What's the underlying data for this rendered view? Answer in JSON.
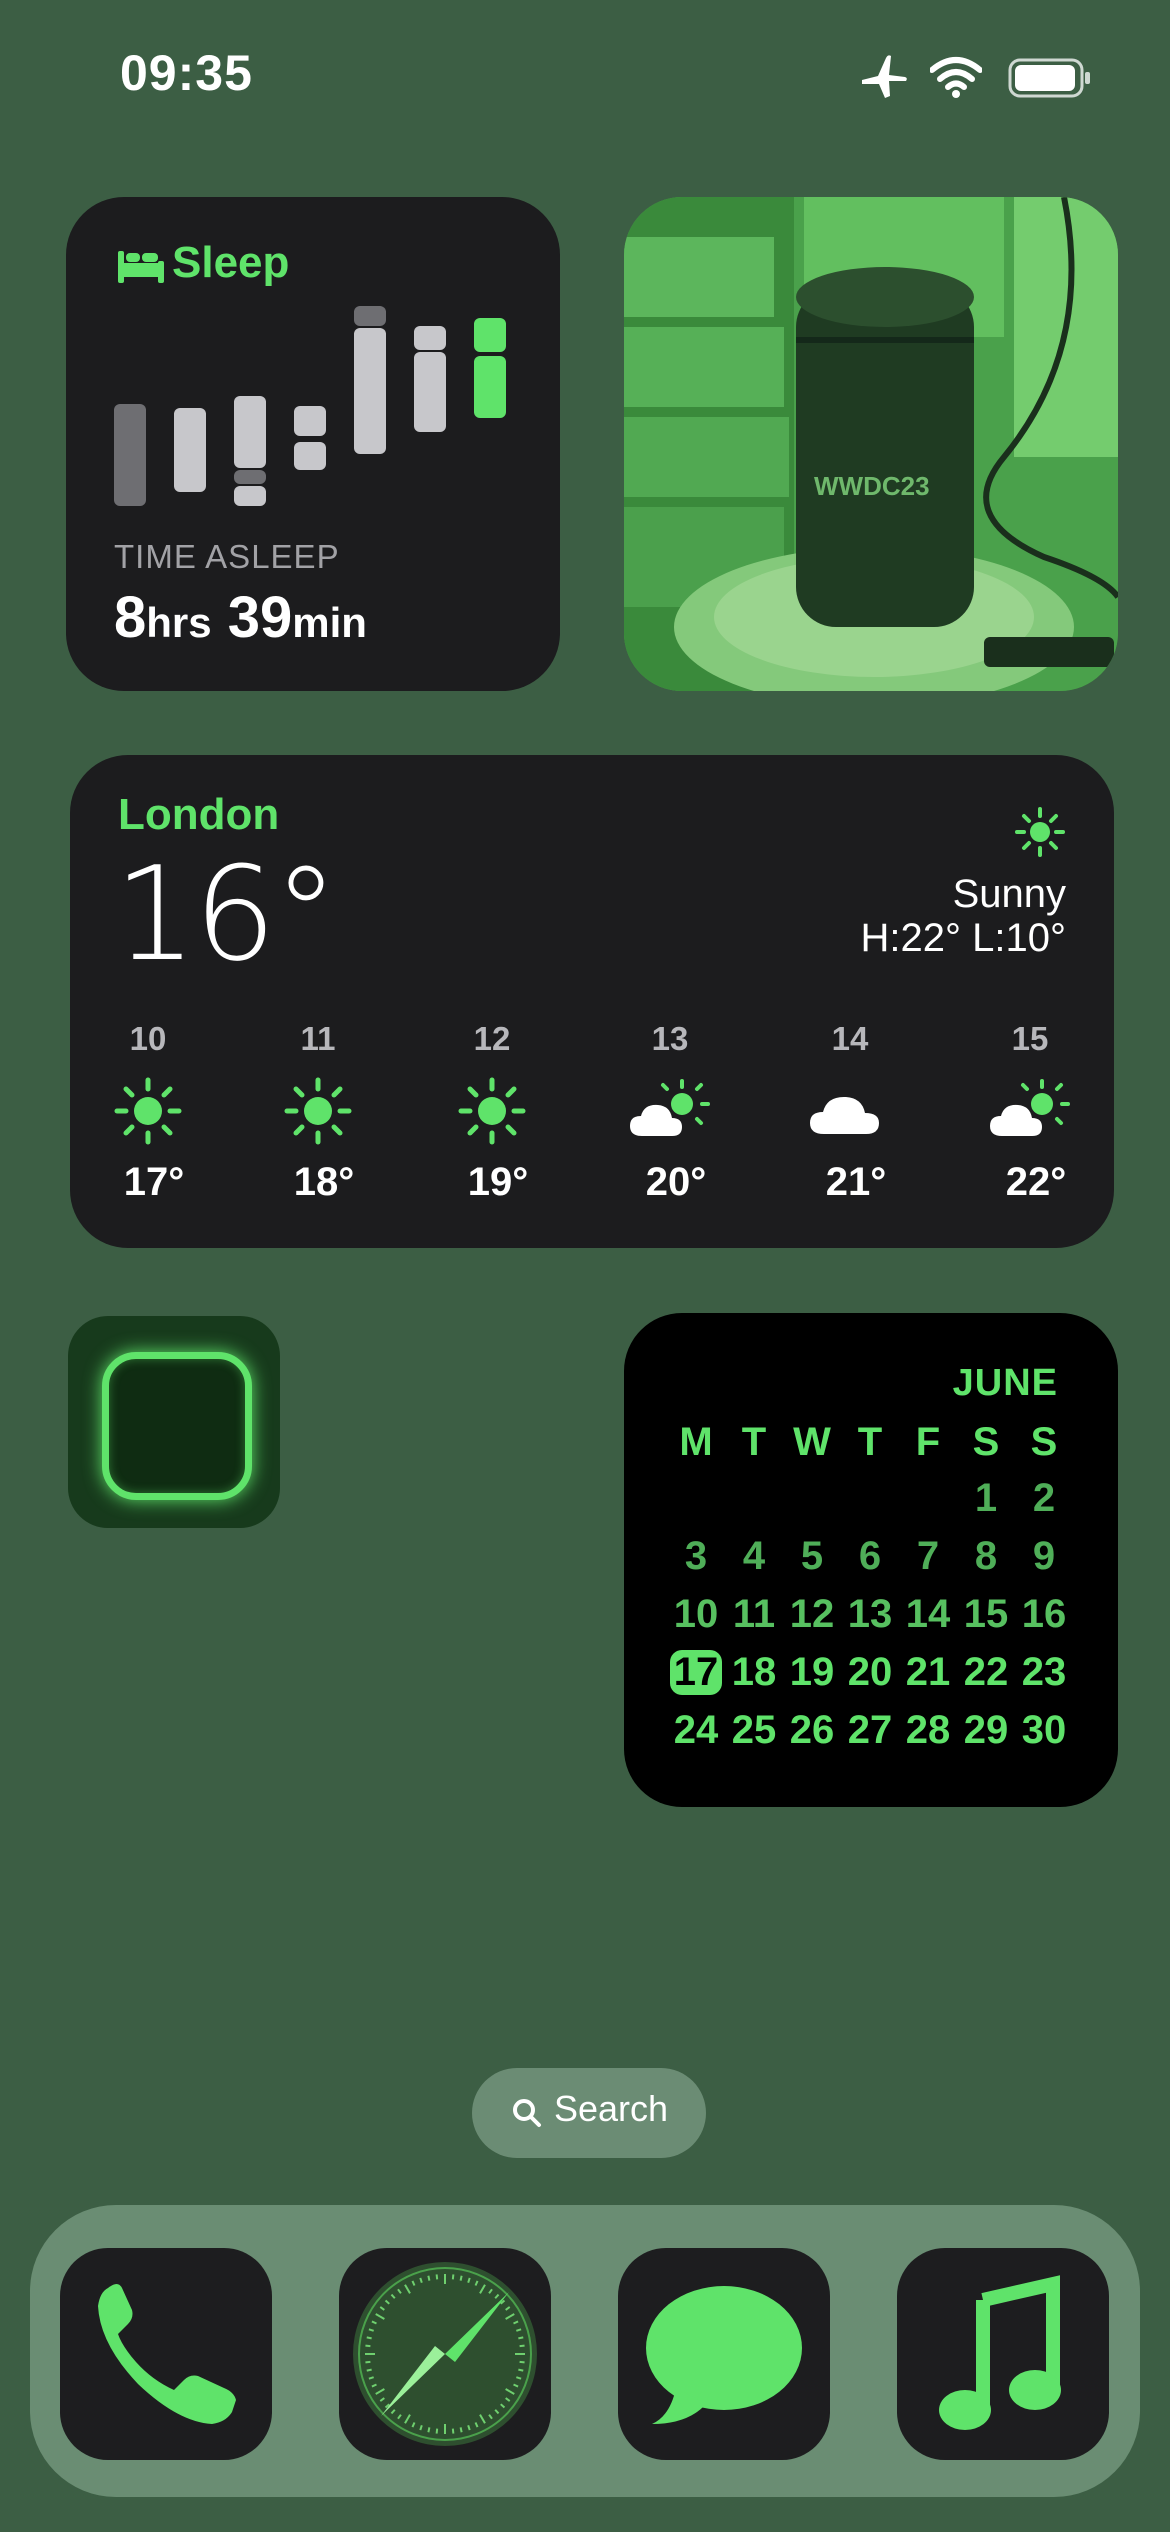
{
  "status_bar": {
    "time": "09:35",
    "icons": [
      "airplane-icon",
      "wifi-icon",
      "battery-icon"
    ]
  },
  "sleep_widget": {
    "title": "Sleep",
    "icon": "bed-icon",
    "label": "TIME ASLEEP",
    "hours": "8",
    "hours_unit": "hrs",
    "minutes": "39",
    "minutes_unit": "min",
    "accent": "#5fe36a"
  },
  "photo_widget": {
    "subject_label": "WWDC23"
  },
  "weather": {
    "city": "London",
    "temperature": "16°",
    "condition": "Sunny",
    "high_low": "H:22° L:10°",
    "condition_icon": "sun-icon",
    "hourly": [
      {
        "hour": "10",
        "icon": "sun-icon",
        "temp": "17°"
      },
      {
        "hour": "11",
        "icon": "sun-icon",
        "temp": "18°"
      },
      {
        "hour": "12",
        "icon": "sun-icon",
        "temp": "19°"
      },
      {
        "hour": "13",
        "icon": "partly-cloudy-icon",
        "temp": "20°"
      },
      {
        "hour": "14",
        "icon": "cloud-icon",
        "temp": "21°"
      },
      {
        "hour": "15",
        "icon": "partly-cloudy-icon",
        "temp": "22°"
      }
    ]
  },
  "calendar": {
    "month": "JUNE",
    "weekdays": [
      "M",
      "T",
      "W",
      "T",
      "F",
      "S",
      "S"
    ],
    "rows": [
      [
        "",
        "",
        "",
        "",
        "",
        "1",
        "2"
      ],
      [
        "3",
        "4",
        "5",
        "6",
        "7",
        "8",
        "9"
      ],
      [
        "10",
        "11",
        "12",
        "13",
        "14",
        "15",
        "16"
      ],
      [
        "17",
        "18",
        "19",
        "20",
        "21",
        "22",
        "23"
      ],
      [
        "24",
        "25",
        "26",
        "27",
        "28",
        "29",
        "30"
      ]
    ],
    "today": "17"
  },
  "search": {
    "label": "Search",
    "icon": "magnifier-icon"
  },
  "dock": {
    "apps": [
      "phone-icon",
      "safari-compass-icon",
      "messages-icon",
      "music-icon"
    ]
  }
}
